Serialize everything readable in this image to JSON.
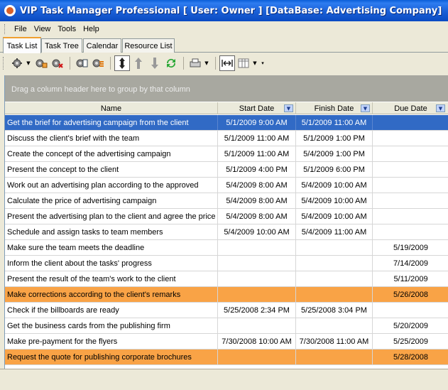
{
  "window": {
    "title": "VIP Task Manager Professional [ User: Owner ] [DataBase: Advertising Company]"
  },
  "menu": [
    "File",
    "View",
    "Tools",
    "Help"
  ],
  "tabs": [
    "Task List",
    "Task Tree",
    "Calendar",
    "Resource List"
  ],
  "toolbar": {
    "icons": [
      "new-task-icon",
      "edit-task-icon",
      "delete-task-icon",
      "task-properties-icon",
      "task-status-icon",
      "sort-icon",
      "move-up-icon",
      "move-down-icon",
      "refresh-icon",
      "print-icon",
      "fit-columns-icon",
      "columns-icon"
    ]
  },
  "grid": {
    "group_hint": "Drag a column header here to group by that column",
    "columns": {
      "name": "Name",
      "start": "Start Date",
      "finish": "Finish Date",
      "due": "Due Date"
    },
    "rows": [
      {
        "name": "Get the brief for advertising campaign from the client",
        "start": "5/1/2009 9:00 AM",
        "finish": "5/1/2009 11:00 AM",
        "due": "",
        "style": "selected"
      },
      {
        "name": "Discuss the client's brief with the team",
        "start": "5/1/2009 11:00 AM",
        "finish": "5/1/2009 1:00 PM",
        "due": "",
        "style": ""
      },
      {
        "name": "Create the concept of the advertising campaign",
        "start": "5/1/2009 11:00 AM",
        "finish": "5/4/2009 1:00 PM",
        "due": "",
        "style": ""
      },
      {
        "name": "Present the concept to the client",
        "start": "5/1/2009 4:00 PM",
        "finish": "5/1/2009 6:00 PM",
        "due": "",
        "style": ""
      },
      {
        "name": "Work out an advertising plan according to the approved",
        "start": "5/4/2009 8:00 AM",
        "finish": "5/4/2009 10:00 AM",
        "due": "",
        "style": ""
      },
      {
        "name": "Calculate the price of advertising campaign",
        "start": "5/4/2009 8:00 AM",
        "finish": "5/4/2009 10:00 AM",
        "due": "",
        "style": ""
      },
      {
        "name": "Present the advertising plan to the client and agree the price",
        "start": "5/4/2009 8:00 AM",
        "finish": "5/4/2009 10:00 AM",
        "due": "",
        "style": ""
      },
      {
        "name": "Schedule and assign tasks to team members",
        "start": "5/4/2009 10:00 AM",
        "finish": "5/4/2009 11:00 AM",
        "due": "",
        "style": ""
      },
      {
        "name": "Make sure the team meets the deadline",
        "start": "",
        "finish": "",
        "due": "5/19/2009",
        "style": ""
      },
      {
        "name": "Inform the client about the tasks' progress",
        "start": "",
        "finish": "",
        "due": "7/14/2009",
        "style": ""
      },
      {
        "name": "Present the result of the team's work to the client",
        "start": "",
        "finish": "",
        "due": "5/11/2009",
        "style": ""
      },
      {
        "name": "Make corrections according to the client's remarks",
        "start": "",
        "finish": "",
        "due": "5/26/2008",
        "style": "highlight"
      },
      {
        "name": "Check if the billboards are ready",
        "start": "5/25/2008 2:34 PM",
        "finish": "5/25/2008 3:04 PM",
        "due": "",
        "style": ""
      },
      {
        "name": "Get the business cards from the publishing firm",
        "start": "",
        "finish": "",
        "due": "5/20/2009",
        "style": ""
      },
      {
        "name": "Make pre-payment for the flyers",
        "start": "7/30/2008 10:00 AM",
        "finish": "7/30/2008 11:00 AM",
        "due": "5/25/2009",
        "style": ""
      },
      {
        "name": "Request the quote for publishing corporate brochures",
        "start": "",
        "finish": "",
        "due": "5/28/2008",
        "style": "highlight"
      }
    ]
  },
  "colors": {
    "selected_row": "#316ac5",
    "highlight_row": "#f9a346",
    "titlebar": "#0a4bc3"
  }
}
